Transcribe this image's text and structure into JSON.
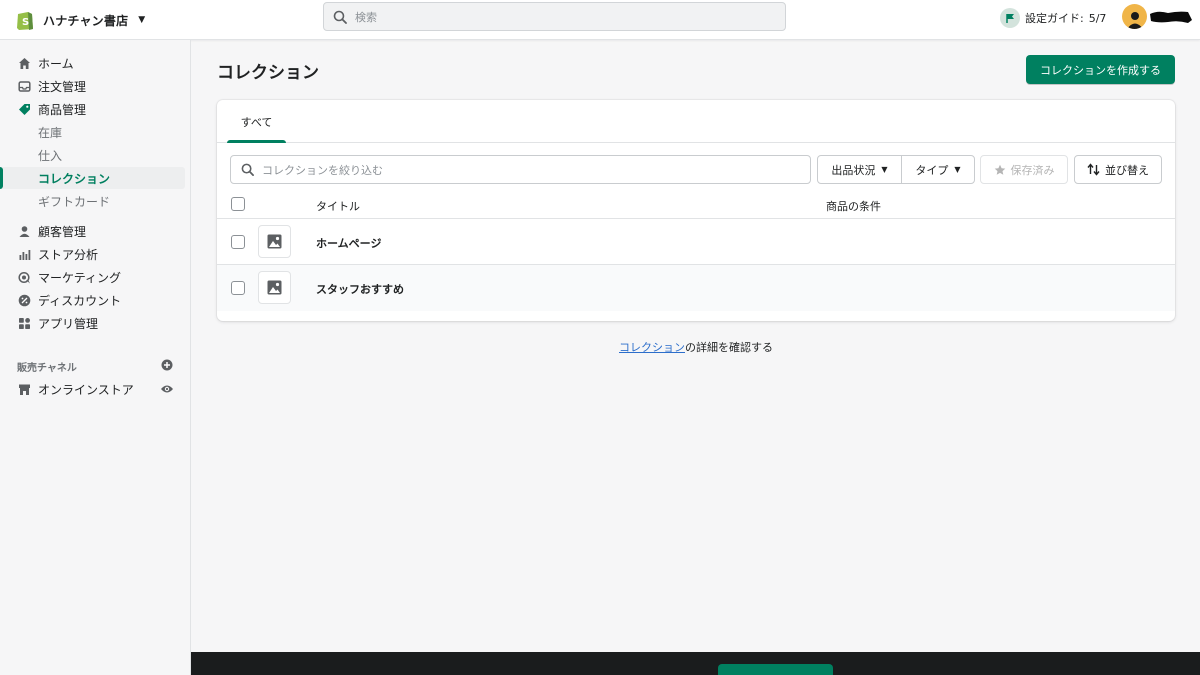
{
  "topbar": {
    "store_name": "ハナチャン書店",
    "search_placeholder": "検索",
    "setup_guide_label": "設定ガイド:",
    "setup_guide_progress": "5/7"
  },
  "sidebar": {
    "items": [
      {
        "label": "ホーム",
        "icon": "home-icon"
      },
      {
        "label": "注文管理",
        "icon": "inbox-icon"
      },
      {
        "label": "商品管理",
        "icon": "tag-icon"
      },
      {
        "label": "顧客管理",
        "icon": "person-icon"
      },
      {
        "label": "ストア分析",
        "icon": "bar-chart-icon"
      },
      {
        "label": "マーケティング",
        "icon": "target-icon"
      },
      {
        "label": "ディスカウント",
        "icon": "discount-icon"
      },
      {
        "label": "アプリ管理",
        "icon": "apps-icon"
      }
    ],
    "product_subitems": [
      "在庫",
      "仕入",
      "コレクション",
      "ギフトカード"
    ],
    "active_subitem": "コレクション",
    "sales_channels_label": "販売チャネル",
    "online_store_label": "オンラインストア"
  },
  "page": {
    "title": "コレクション",
    "create_button": "コレクションを作成する"
  },
  "tabs": [
    "すべて"
  ],
  "filters": {
    "filter_placeholder": "コレクションを絞り込む",
    "status_label": "出品状況",
    "type_label": "タイプ",
    "saved_label": "保存済み",
    "sort_label": "並び替え"
  },
  "table": {
    "headers": {
      "title": "タイトル",
      "conditions": "商品の条件"
    },
    "rows": [
      {
        "title": "ホームページ",
        "conditions": ""
      },
      {
        "title": "スタッフおすすめ",
        "conditions": ""
      }
    ]
  },
  "learn_more": {
    "link": "コレクション",
    "suffix": "の詳細を確認する"
  },
  "colors": {
    "accent": "#008060",
    "link": "#2c6ecb",
    "background": "#f6f6f7",
    "bottom_bar": "#1a1c1d"
  }
}
